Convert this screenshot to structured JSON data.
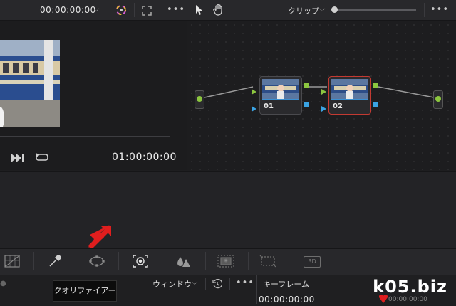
{
  "topbar": {
    "timecode": "00:00:00:00",
    "clip_label": "クリップ",
    "more": "•••"
  },
  "viewer": {
    "timecode": "01:00:00:00"
  },
  "nodes": [
    {
      "label": "01"
    },
    {
      "label": "02"
    }
  ],
  "bottombar": {
    "tooltip": "クオリファイアー",
    "window_label": "ウィンドウ",
    "keyframe_label": "キーフレーム",
    "keyframe_tc_1": "00:00:00:00",
    "keyframe_tc_2": "00:00:00:00",
    "more": "•••"
  },
  "toolstrip": {
    "three_d": "3D"
  },
  "watermark": "k05.biz",
  "colors": {
    "accent_red": "#e01e1e",
    "node_selected": "#c33a32",
    "link_green": "#8cc63f",
    "link_blue": "#3aa3e3"
  }
}
